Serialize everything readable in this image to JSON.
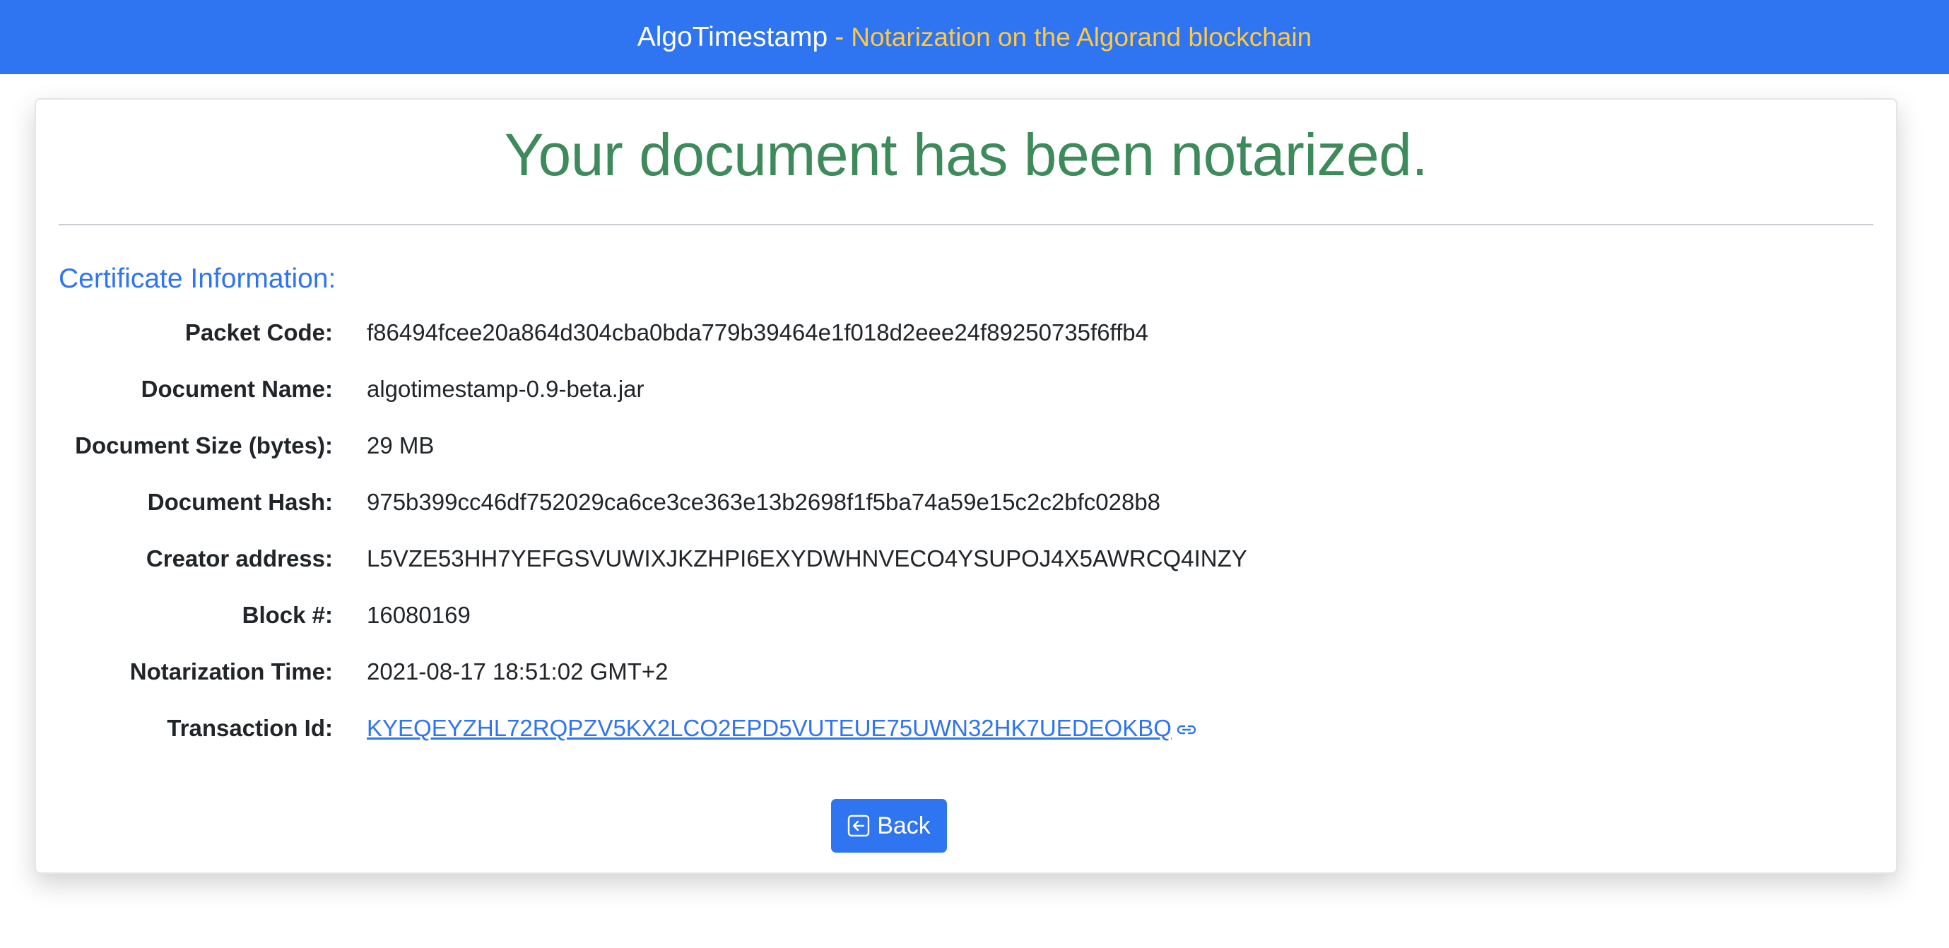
{
  "header": {
    "brand": "AlgoTimestamp",
    "separator": "-",
    "tagline": "Notarization on the Algorand blockchain"
  },
  "card": {
    "headline": "Your document has been notarized.",
    "section_title": "Certificate Information:",
    "fields": [
      {
        "label": "Packet Code:",
        "value": "f86494fcee20a864d304cba0bda779b39464e1f018d2eee24f89250735f6ffb4"
      },
      {
        "label": "Document Name:",
        "value": "algotimestamp-0.9-beta.jar"
      },
      {
        "label": "Document Size (bytes):",
        "value": "29 MB"
      },
      {
        "label": "Document Hash:",
        "value": "975b399cc46df752029ca6ce3ce363e13b2698f1f5ba74a59e15c2c2bfc028b8"
      },
      {
        "label": "Creator address:",
        "value": "L5VZE53HH7YEFGSVUWIXJKZHPI6EXYDWHNVECO4YSUPOJ4X5AWRCQ4INZY"
      },
      {
        "label": "Block #:",
        "value": "16080169"
      },
      {
        "label": "Notarization Time:",
        "value": "2021-08-17 18:51:02 GMT+2"
      },
      {
        "label": "Transaction Id:",
        "value": "KYEQEYZHL72RQPZV5KX2LCO2EPD5VUTEUE75UWN32HK7UEDEOKBQ"
      }
    ],
    "back_label": "Back"
  },
  "colors": {
    "header_bg": "#2f74f0",
    "tagline": "#ffc941",
    "headline": "#3d8a5a",
    "accent": "#2f74f0"
  },
  "icons": {
    "transaction_link": "external-link-icon",
    "back": "back-arrow-icon"
  }
}
